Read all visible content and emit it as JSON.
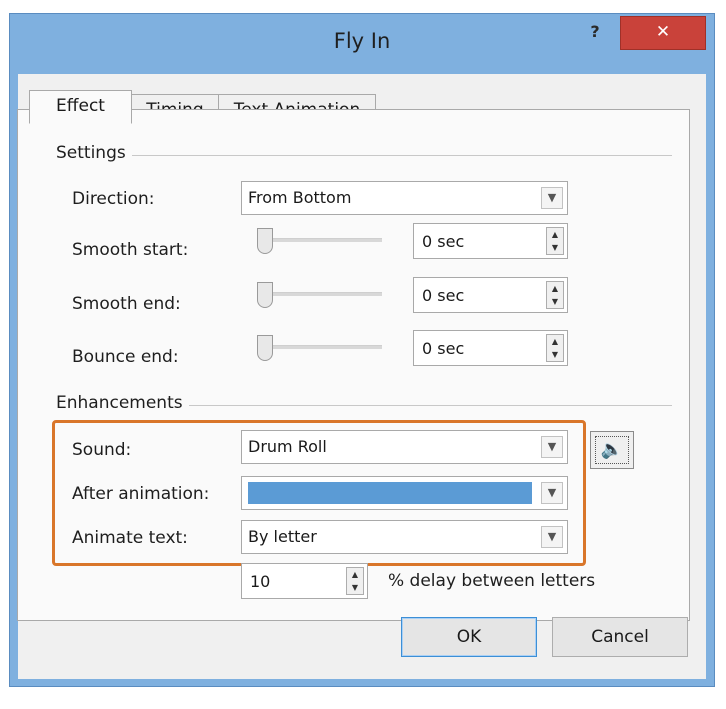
{
  "dialog": {
    "title": "Fly In",
    "help_label": "?",
    "close_label": "✕"
  },
  "tabs": [
    {
      "label": "Effect"
    },
    {
      "label": "Timing"
    },
    {
      "label": "Text Animation"
    }
  ],
  "settings": {
    "group_label": "Settings",
    "direction": {
      "label": "Direction:",
      "value": "From Bottom"
    },
    "smooth_start": {
      "label": "Smooth start:",
      "value": "0 sec",
      "slider_fraction": 0
    },
    "smooth_end": {
      "label": "Smooth end:",
      "value": "0 sec",
      "slider_fraction": 0
    },
    "bounce_end": {
      "label": "Bounce end:",
      "value": "0 sec",
      "slider_fraction": 0
    }
  },
  "enhancements": {
    "group_label": "Enhancements",
    "sound": {
      "label": "Sound:",
      "value": "Drum Roll"
    },
    "after_animation": {
      "label": "After animation:",
      "value": "",
      "swatch_color": "#5b9bd5"
    },
    "animate_text": {
      "label": "Animate text:",
      "value": "By letter"
    },
    "delay": {
      "value": "10",
      "suffix": "% delay between letters"
    }
  },
  "buttons": {
    "ok": "OK",
    "cancel": "Cancel"
  },
  "colors": {
    "title_bar": "#7fb0df",
    "close_button": "#c9423a",
    "highlight_box": "#d9762a"
  },
  "icons": {
    "speaker": "speaker-icon",
    "dropdown": "chevron-down-icon",
    "spinner": "spinner-arrows-icon"
  }
}
